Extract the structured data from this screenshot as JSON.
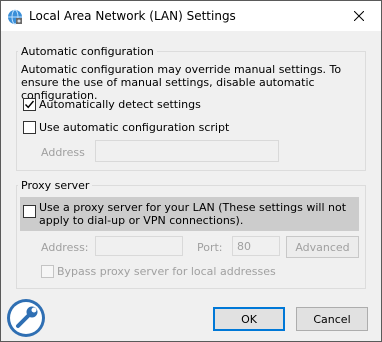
{
  "window": {
    "title": "Local Area Network (LAN) Settings",
    "close_icon": "close-icon"
  },
  "automatic": {
    "legend": "Automatic configuration",
    "description": "Automatic configuration may override manual settings.  To ensure the use of manual settings, disable automatic configuration.",
    "detect_label": "Automatically detect settings",
    "detect_checked": true,
    "script_label": "Use automatic configuration script",
    "script_checked": false,
    "address_label": "Address",
    "address_value": ""
  },
  "proxy": {
    "legend": "Proxy server",
    "use_proxy_label": "Use a proxy server for your LAN (These settings will not apply to dial-up or VPN connections).",
    "use_proxy_checked": false,
    "address_label": "Address:",
    "address_value": "",
    "port_label": "Port:",
    "port_value": "80",
    "advanced_label": "Advanced",
    "bypass_label": "Bypass proxy server for local addresses",
    "bypass_checked": false
  },
  "buttons": {
    "ok": "OK",
    "cancel": "Cancel"
  },
  "colors": {
    "highlight": "#cccccc",
    "accent": "#0078d7"
  }
}
